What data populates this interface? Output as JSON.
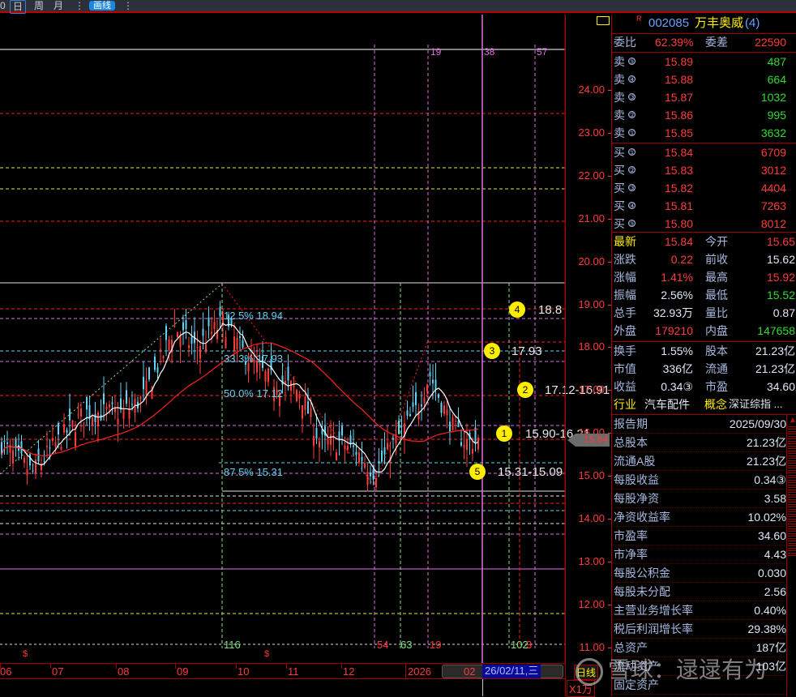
{
  "toolbar": {
    "items": [
      "0",
      "日",
      "周",
      "月",
      "⋮",
      "画线",
      "⋮"
    ],
    "selected": "日"
  },
  "axis": {
    "prices": [
      "24.00",
      "23.00",
      "22.00",
      "21.00",
      "20.00",
      "19.00",
      "18.00",
      "17.00",
      "16.00",
      "15.00",
      "14.00",
      "13.00",
      "12.00",
      "11.00"
    ],
    "current_price": "15.84",
    "period_label": "日线",
    "unit_label": "X1万"
  },
  "time_axis": {
    "labels": [
      "06",
      "07",
      "08",
      "09",
      "10",
      "11",
      "12",
      "2026",
      "02"
    ],
    "cursor_date": "26/02/11,三"
  },
  "drawings": {
    "fib_labels": [
      "12.5% 18.94",
      "33.3% 17.93",
      "50.0% 17.12",
      "87.5% 15.31"
    ],
    "markers": [
      {
        "num": "4",
        "text": "18.8"
      },
      {
        "num": "3",
        "text": "17.93"
      },
      {
        "num": "2",
        "text": "17.12-16.91"
      },
      {
        "num": "1",
        "text": "15.90-16.21"
      },
      {
        "num": "5",
        "text": "15.31-15.09"
      }
    ],
    "top_counts": [
      "19",
      "38",
      "57"
    ],
    "bottom_counts": [
      "116",
      "54",
      "63",
      "19",
      "102",
      "3"
    ],
    "signal_marks": [
      "$",
      "$"
    ]
  },
  "quote": {
    "code": "002085",
    "name": "万丰奥威",
    "suffix": "(4)",
    "flag": "R",
    "weibi_label": "委比",
    "weibi": "62.39%",
    "weicha_label": "委差",
    "weicha": "22590",
    "asks": [
      {
        "label": "卖",
        "lvl": "⑤",
        "price": "15.89",
        "vol": "487"
      },
      {
        "label": "卖",
        "lvl": "④",
        "price": "15.88",
        "vol": "664"
      },
      {
        "label": "卖",
        "lvl": "③",
        "price": "15.87",
        "vol": "1032"
      },
      {
        "label": "卖",
        "lvl": "②",
        "price": "15.86",
        "vol": "995"
      },
      {
        "label": "卖",
        "lvl": "①",
        "price": "15.85",
        "vol": "3632"
      }
    ],
    "bids": [
      {
        "label": "买",
        "lvl": "①",
        "price": "15.84",
        "vol": "6709"
      },
      {
        "label": "买",
        "lvl": "②",
        "price": "15.83",
        "vol": "3012"
      },
      {
        "label": "买",
        "lvl": "③",
        "price": "15.82",
        "vol": "4404"
      },
      {
        "label": "买",
        "lvl": "④",
        "price": "15.81",
        "vol": "7263"
      },
      {
        "label": "买",
        "lvl": "⑤",
        "price": "15.80",
        "vol": "8012"
      }
    ],
    "stats": [
      {
        "l1": "最新",
        "v1": "15.84",
        "c1": "red",
        "l2": "今开",
        "v2": "15.65",
        "c2": "red"
      },
      {
        "l1": "涨跌",
        "v1": "0.22",
        "c1": "red",
        "l2": "前收",
        "v2": "15.62",
        "c2": "wht"
      },
      {
        "l1": "涨幅",
        "v1": "1.41%",
        "c1": "red",
        "l2": "最高",
        "v2": "15.92",
        "c2": "red"
      },
      {
        "l1": "振幅",
        "v1": "2.56%",
        "c1": "wht",
        "l2": "最低",
        "v2": "15.52",
        "c2": "grn"
      },
      {
        "l1": "总手",
        "v1": "32.93万",
        "c1": "wht",
        "l2": "量比",
        "v2": "0.87",
        "c2": "wht"
      },
      {
        "l1": "外盘",
        "v1": "179210",
        "c1": "red",
        "l2": "内盘",
        "v2": "147658",
        "c2": "grn"
      }
    ],
    "stats2": [
      {
        "l1": "换手",
        "v1": "1.55%",
        "l2": "股本",
        "v2": "21.23亿"
      },
      {
        "l1": "市值",
        "v1": "336亿",
        "l2": "流通",
        "v2": "21.23亿"
      },
      {
        "l1": "收益",
        "v1": "0.34③",
        "l2": "市盈",
        "v2": "34.60"
      }
    ],
    "industry_label": "行业",
    "industry": "汽车配件",
    "concept_label": "概念",
    "concept": "深证综指 ..."
  },
  "finance": [
    {
      "k": "报告期",
      "v": "2025/09/30"
    },
    {
      "k": "总股本",
      "v": "21.23亿"
    },
    {
      "k": "流通A股",
      "v": "21.23亿"
    },
    {
      "k": "每股收益",
      "v": "0.34③"
    },
    {
      "k": "每股净资",
      "v": "3.58"
    },
    {
      "k": "净资收益率",
      "v": "10.02%"
    },
    {
      "k": "市盈率",
      "v": "34.60"
    },
    {
      "k": "市净率",
      "v": "4.43"
    },
    {
      "k": "每股公积金",
      "v": "0.030"
    },
    {
      "k": "每股未分配",
      "v": "2.56"
    },
    {
      "k": "主营业务增长率",
      "v": "0.40%"
    },
    {
      "k": "税后利润增长率",
      "v": "29.38%"
    },
    {
      "k": "总资产",
      "v": "187亿"
    },
    {
      "k": "流动资产",
      "v": "103亿"
    },
    {
      "k": "固定资产",
      "v": ""
    }
  ],
  "watermark": "雪球：逯逯有为",
  "colors": {
    "up": "#ff3a3a",
    "down": "#5fd3f3",
    "ma_short": "#ffffff",
    "ma_long": "#ff2020",
    "accent": "#ffee00",
    "frame": "#a00000"
  }
}
